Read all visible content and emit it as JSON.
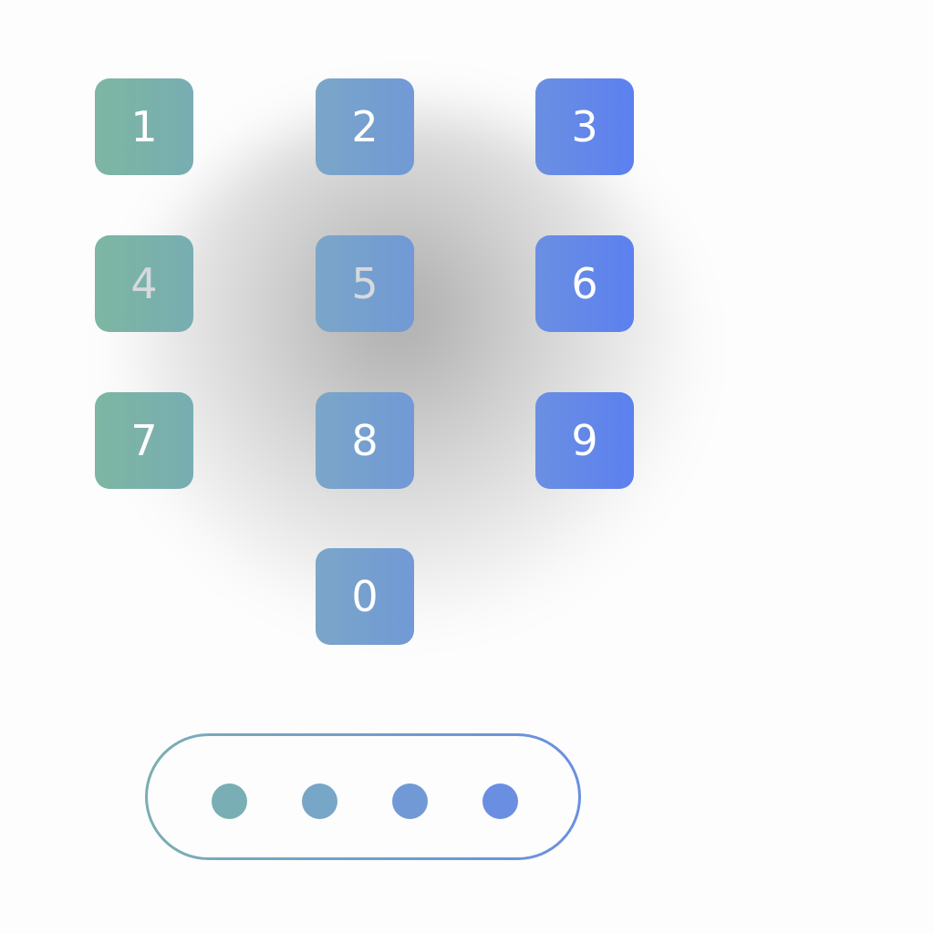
{
  "keypad": {
    "keys": [
      {
        "label": "1"
      },
      {
        "label": "2"
      },
      {
        "label": "3"
      },
      {
        "label": "4"
      },
      {
        "label": "5"
      },
      {
        "label": "6"
      },
      {
        "label": "7"
      },
      {
        "label": "8"
      },
      {
        "label": "9"
      },
      {
        "label": "0"
      }
    ]
  },
  "pin": {
    "digits_entered": 4,
    "dot_colors": [
      "#7aaeb5",
      "#77a6c6",
      "#7199d6",
      "#6a8fe2"
    ]
  },
  "colors": {
    "key_left": "#7db6a2",
    "key_middle": "#7ba6c8",
    "key_right": "#5c80ef",
    "background": "#fdfdfd"
  }
}
